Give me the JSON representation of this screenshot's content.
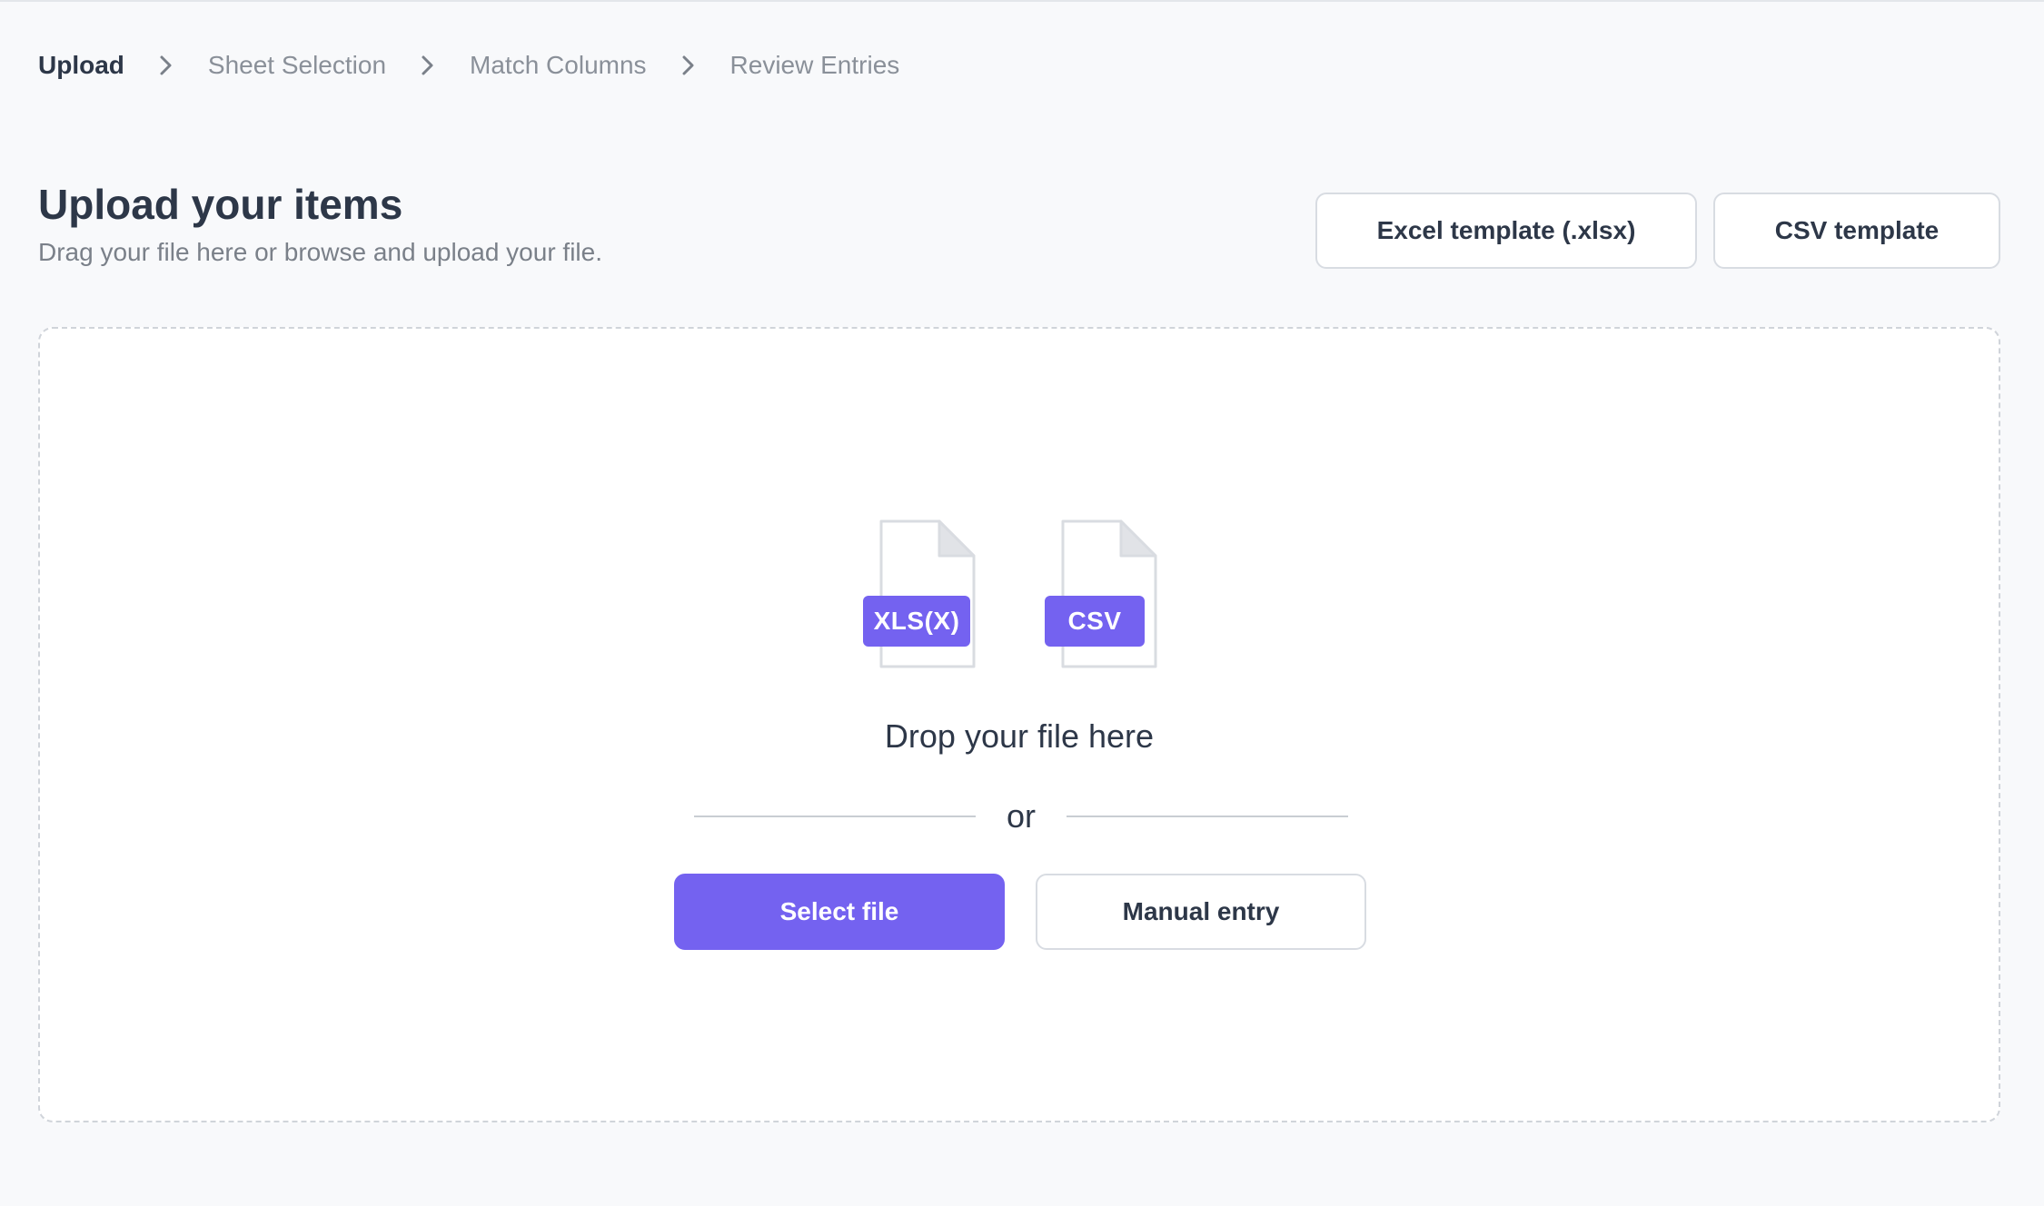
{
  "breadcrumb": {
    "steps": [
      {
        "label": "Upload",
        "active": true
      },
      {
        "label": "Sheet Selection",
        "active": false
      },
      {
        "label": "Match Columns",
        "active": false
      },
      {
        "label": "Review Entries",
        "active": false
      }
    ]
  },
  "header": {
    "title": "Upload your items",
    "subtitle": "Drag your file here or browse and upload your file.",
    "excel_template_label": "Excel template (.xlsx)",
    "csv_template_label": "CSV template"
  },
  "dropzone": {
    "file_types": [
      {
        "badge": "XLS(X)",
        "icon": "xlsx-file-icon"
      },
      {
        "badge": "CSV",
        "icon": "csv-file-icon"
      }
    ],
    "drop_text": "Drop your file here",
    "divider_text": "or",
    "select_file_label": "Select file",
    "manual_entry_label": "Manual entry"
  },
  "colors": {
    "accent": "#7462f0",
    "text_primary": "#2d3748",
    "text_muted": "#8a9099",
    "background": "#f8f9fb"
  }
}
